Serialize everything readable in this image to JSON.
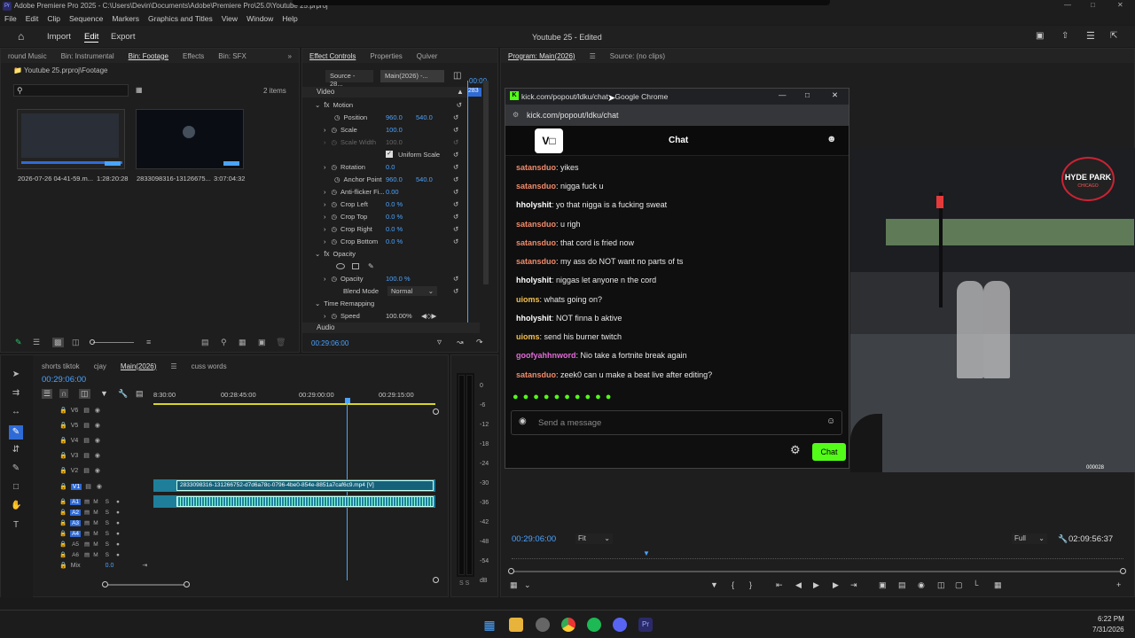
{
  "window": {
    "title": "Adobe Premiere Pro 2025 - C:\\Users\\Devin\\Documents\\Adobe\\Premiere Pro\\25.0\\Youtube 25.prproj"
  },
  "menu": [
    "File",
    "Edit",
    "Clip",
    "Sequence",
    "Markers",
    "Graphics and Titles",
    "View",
    "Window",
    "Help"
  ],
  "appbar": {
    "tabs": [
      "Import",
      "Edit",
      "Export"
    ],
    "active": "Edit",
    "project_title": "Youtube 25 - Edited"
  },
  "project_panel": {
    "tabs": [
      "round Music",
      "Bin: Instrumental",
      "Bin: Footage",
      "Effects",
      "Bin: SFX"
    ],
    "path": "Youtube 25.prproj\\Footage",
    "search_placeholder": "",
    "item_count": "2 items",
    "clips": [
      {
        "name": "2026-07-26 04-41-59.m...",
        "duration": "1:28:20:28"
      },
      {
        "name": "2833098316-13126675...",
        "duration": "3:07:04:32"
      }
    ]
  },
  "effect_controls": {
    "tabs": [
      "Effect Controls",
      "Properties",
      "Quiver"
    ],
    "source": "Source - 28...",
    "main": "Main(2026) -...",
    "playhead_time": "00:29:06:00",
    "sections": {
      "video": "Video",
      "audio": "Audio"
    },
    "motion": "Motion",
    "position": {
      "label": "Position",
      "x": "960.0",
      "y": "540.0"
    },
    "scale": {
      "label": "Scale",
      "value": "100.0"
    },
    "scale_width": {
      "label": "Scale Width",
      "value": "100.0"
    },
    "uniform_scale": "Uniform Scale",
    "rotation": {
      "label": "Rotation",
      "value": "0.0"
    },
    "anchor_point": {
      "label": "Anchor Point",
      "x": "960.0",
      "y": "540.0"
    },
    "anti_flicker": {
      "label": "Anti-flicker Fi...",
      "value": "0.00"
    },
    "crop_left": {
      "label": "Crop Left",
      "value": "0.0 %"
    },
    "crop_top": {
      "label": "Crop Top",
      "value": "0.0 %"
    },
    "crop_right": {
      "label": "Crop Right",
      "value": "0.0 %"
    },
    "crop_bottom": {
      "label": "Crop Bottom",
      "value": "0.0 %"
    },
    "opacity_section": "Opacity",
    "opacity": {
      "label": "Opacity",
      "value": "100.0 %"
    },
    "blend_mode": {
      "label": "Blend Mode",
      "value": "Normal"
    },
    "time_remapping": "Time Remapping",
    "speed": {
      "label": "Speed",
      "value": "100.00%"
    },
    "ruler_time": "00:00",
    "ruler_marker": "283"
  },
  "program": {
    "tabs": [
      "Program: Main(2026)",
      "Source: (no clips)"
    ],
    "timecode": "00:29:06:00",
    "fit": "Fit",
    "full": "Full",
    "duration": "02:09:56:37",
    "video_logo_line1": "HYDE PARK",
    "video_logo_line2": "CHICAGO",
    "overlay_counter": "000028"
  },
  "chrome": {
    "title": "kick.com/popout/ldku/chat - Google Chrome",
    "url": "kick.com/popout/ldku/chat",
    "header": "Chat",
    "messages": [
      {
        "user": "satansduo",
        "text": ": yikes",
        "color": "#f28b6a"
      },
      {
        "user": "satansduo",
        "text": ": nigga fuck u",
        "color": "#f28b6a"
      },
      {
        "user": "hholyshit",
        "text": ": yo that nigga is a fucking sweat",
        "color": "#ffffff"
      },
      {
        "user": "satansduo",
        "text": ": u righ",
        "color": "#f28b6a"
      },
      {
        "user": "satansduo",
        "text": ": that cord is fried now",
        "color": "#f28b6a"
      },
      {
        "user": "satansduo",
        "text": ": my ass do NOT want no parts of ts",
        "color": "#f28b6a"
      },
      {
        "user": "hholyshit",
        "text": ": niggas let anyone n the cord",
        "color": "#ffffff"
      },
      {
        "user": "uioms",
        "text": ": whats going on?",
        "color": "#f4c04e"
      },
      {
        "user": "hholyshit",
        "text": ": NOT finna b aktive",
        "color": "#ffffff"
      },
      {
        "user": "uioms",
        "text": ": send his burner twitch",
        "color": "#f4c04e"
      },
      {
        "user": "goofyahhnword",
        "text": ": Nio take a fortnite break again",
        "color": "#e36bd9"
      },
      {
        "user": "satansduo",
        "text": ": zeek0 can u make a beat live after editing?",
        "color": "#f28b6a"
      }
    ],
    "input_placeholder": "Send a message",
    "send_label": "Chat",
    "accent": "#53fc18"
  },
  "timeline": {
    "tabs": [
      "shorts tiktok",
      "cjay",
      "Main(2026)",
      "cuss words"
    ],
    "timecode": "00:29:06:00",
    "ruler": [
      "8:30:00",
      "00:28:45:00",
      "00:29:00:00",
      "00:29:15:00"
    ],
    "video_tracks": [
      "V6",
      "V5",
      "V4",
      "V3",
      "V2",
      "V1"
    ],
    "audio_tracks": [
      "A1",
      "A2",
      "A3",
      "A4",
      "A5",
      "A6"
    ],
    "mix_label": "Mix",
    "mix_value": "0.0",
    "clip_name": "2833098316-131266752-d7d6a78c-0796-4be0-854e-8851a7caf6c9.mp4 [V]",
    "meter_scale": [
      "0",
      "-6",
      "-12",
      "-18",
      "-24",
      "-30",
      "-36",
      "-42",
      "-48",
      "-54",
      "dB"
    ],
    "meter_solo": "S S"
  },
  "taskbar": {
    "time": "6:22 PM",
    "date": "7/31/2026"
  }
}
